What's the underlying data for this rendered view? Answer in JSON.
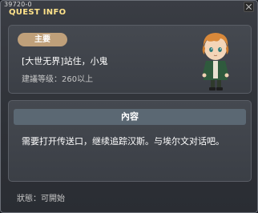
{
  "window": {
    "quest_id": "39720-0",
    "title": "QUEST INFO"
  },
  "info": {
    "badge": "主要",
    "quest_name": "[大世无界]站住，小鬼",
    "required_level": "建議等级：260以上"
  },
  "content": {
    "header": "內容",
    "description": "需要打开传送口，继续追踪汉斯。与埃尔文对话吧。"
  },
  "status": {
    "text": "狀態：可開始"
  },
  "colors": {
    "title_text": "#ffe38a",
    "badge_bg": "#bfa07a",
    "section_header_bg": "#5b6873",
    "npc_hair": "#d9893a"
  },
  "icons": {
    "npc": "npc-portrait",
    "close": "close-icon"
  }
}
